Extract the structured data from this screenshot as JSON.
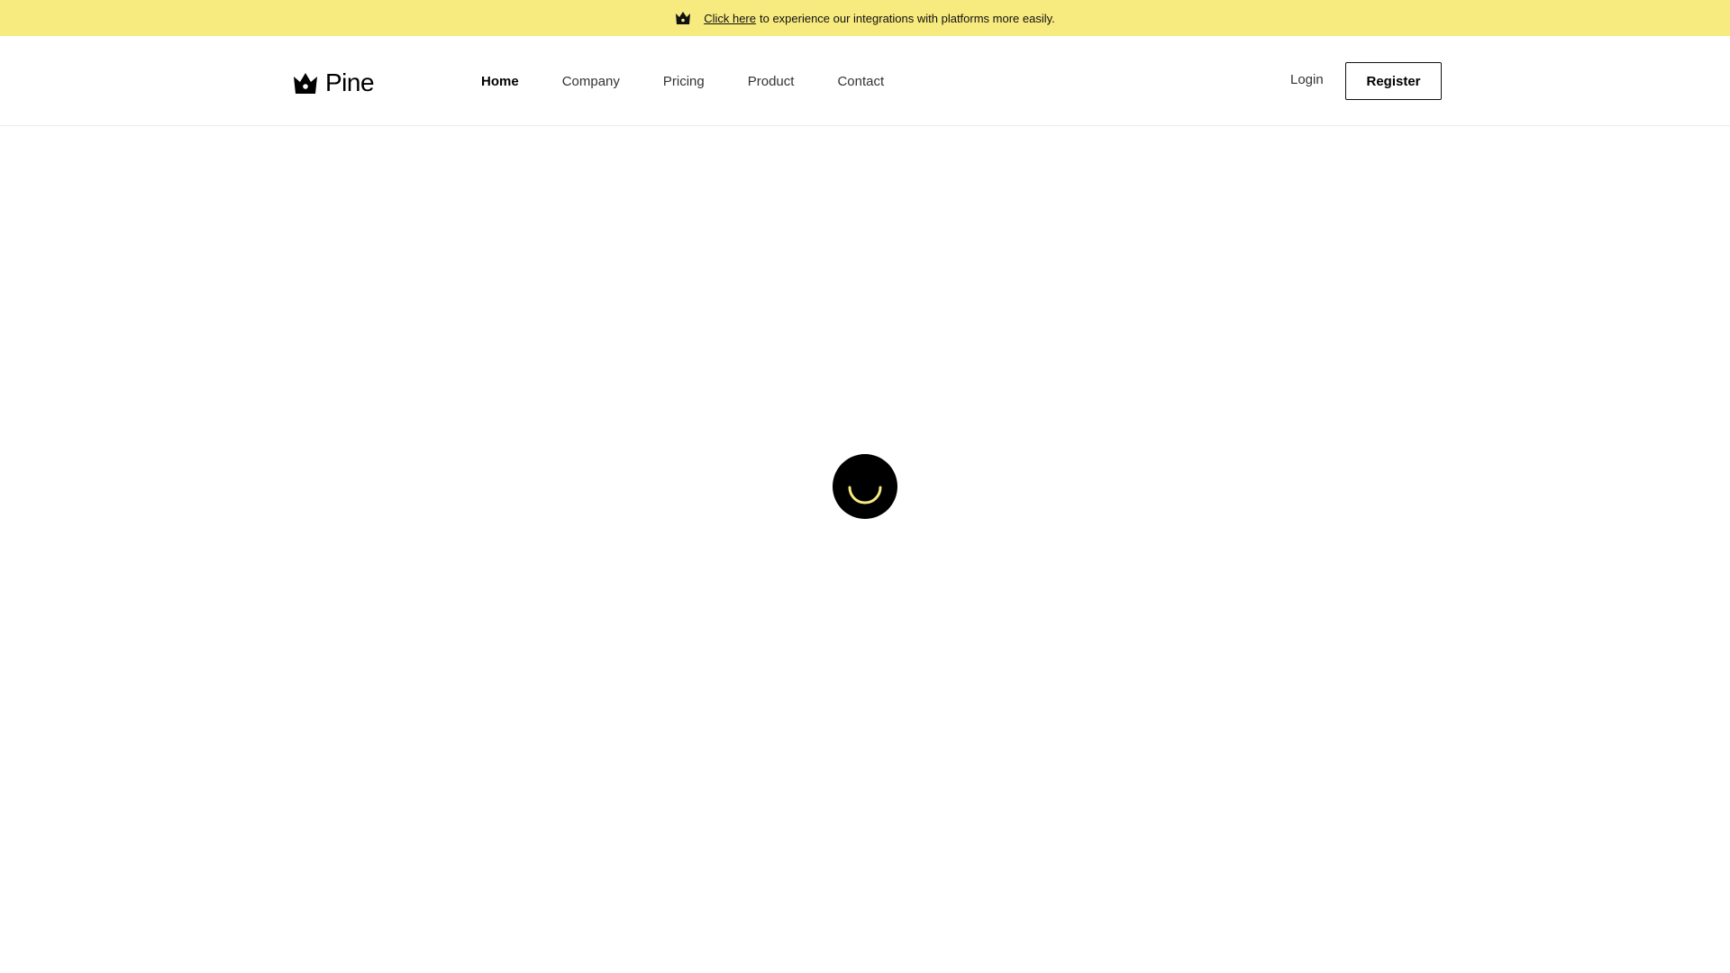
{
  "announcement": {
    "icon": "crown-icon",
    "link_text": "Click here",
    "message": "to experience our integrations with platforms more easily."
  },
  "header": {
    "logo": {
      "icon": "crown-icon",
      "text": "Pine"
    },
    "nav": [
      {
        "label": "Home",
        "active": true
      },
      {
        "label": "Company",
        "active": false
      },
      {
        "label": "Pricing",
        "active": false
      },
      {
        "label": "Product",
        "active": false
      },
      {
        "label": "Contact",
        "active": false
      }
    ],
    "login_label": "Login",
    "register_label": "Register"
  },
  "loader": {
    "icon": "smile-spinner-icon",
    "accent": "#f7ea7f"
  },
  "colors": {
    "banner": "#f7ea7f",
    "text": "#111111",
    "border": "#ececec",
    "loader_bg": "#000000"
  }
}
